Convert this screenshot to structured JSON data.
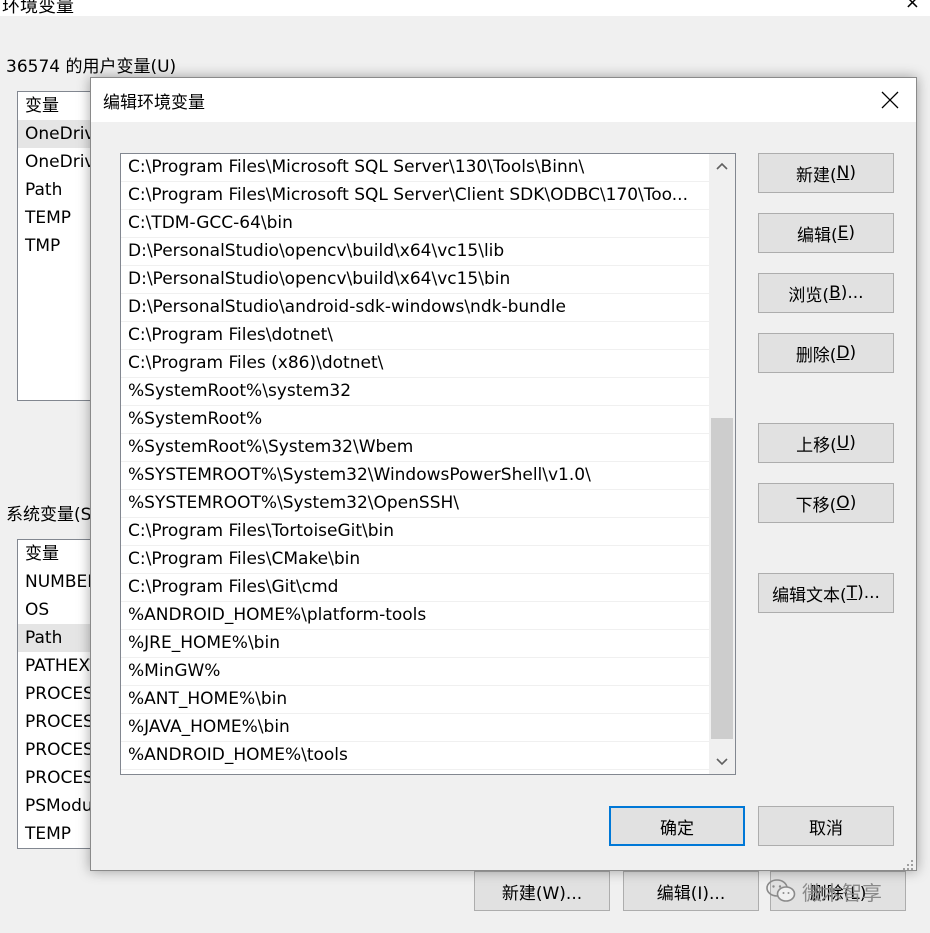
{
  "background": {
    "title_fragment": "环境变量",
    "title_x": "×",
    "user_vars_label": "36574 的用户变量(U)",
    "user_vars_header": "变量",
    "user_vars": [
      "OneDrive",
      "OneDrive",
      "Path",
      "TEMP",
      "TMP"
    ],
    "sys_vars_label": "系统变量(S)",
    "sys_vars_header": "变量",
    "sys_vars": [
      "NUMBER_OF_PROCESSORS",
      "OS",
      "Path",
      "PATHEXT",
      "PROCESSOR_ARCHITECTURE",
      "PROCESSOR_IDENTIFIER",
      "PROCESSOR_LEVEL",
      "PROCESSOR_REVISION",
      "PSModulePath",
      "TEMP"
    ],
    "buttons": {
      "new": "新建(W)...",
      "new_key": "W",
      "edit": "编辑(I)...",
      "edit_key": "I",
      "delete": "删除(L)"
    }
  },
  "dialog": {
    "title": "编辑环境变量",
    "paths": [
      "C:\\Program Files\\Microsoft SQL Server\\130\\Tools\\Binn\\",
      "C:\\Program Files\\Microsoft SQL Server\\Client SDK\\ODBC\\170\\Too...",
      "C:\\TDM-GCC-64\\bin",
      "D:\\PersonalStudio\\opencv\\build\\x64\\vc15\\lib",
      "D:\\PersonalStudio\\opencv\\build\\x64\\vc15\\bin",
      "D:\\PersonalStudio\\android-sdk-windows\\ndk-bundle",
      "C:\\Program Files\\dotnet\\",
      "C:\\Program Files (x86)\\dotnet\\",
      "%SystemRoot%\\system32",
      "%SystemRoot%",
      "%SystemRoot%\\System32\\Wbem",
      "%SYSTEMROOT%\\System32\\WindowsPowerShell\\v1.0\\",
      "%SYSTEMROOT%\\System32\\OpenSSH\\",
      "C:\\Program Files\\TortoiseGit\\bin",
      "C:\\Program Files\\CMake\\bin",
      "C:\\Program Files\\Git\\cmd",
      "%ANDROID_HOME%\\platform-tools",
      "%JRE_HOME%\\bin",
      "%MinGW%",
      "%ANT_HOME%\\bin",
      "%JAVA_HOME%\\bin",
      "%ANDROID_HOME%\\tools"
    ],
    "scroll": {
      "thumb_start_fraction": 0.42,
      "thumb_end_fraction": 0.98
    },
    "buttons": {
      "new": {
        "pre": "新建(",
        "key": "N",
        "post": ")"
      },
      "edit": {
        "pre": "编辑(",
        "key": "E",
        "post": ")"
      },
      "browse": {
        "pre": "浏览(",
        "key": "B",
        "post": ")..."
      },
      "delete": {
        "pre": "删除(",
        "key": "D",
        "post": ")"
      },
      "move_up": {
        "pre": "上移(",
        "key": "U",
        "post": ")"
      },
      "move_down": {
        "pre": "下移(",
        "key": "O",
        "post": ")"
      },
      "edit_text": {
        "pre": "编辑文本(",
        "key": "T",
        "post": ")..."
      },
      "ok": "确定",
      "cancel": "取消"
    }
  },
  "watermark": "微木智享",
  "colors": {
    "accent": "#0078d7",
    "button_face": "#e1e1e1",
    "window_bg": "#f0f0f0"
  }
}
